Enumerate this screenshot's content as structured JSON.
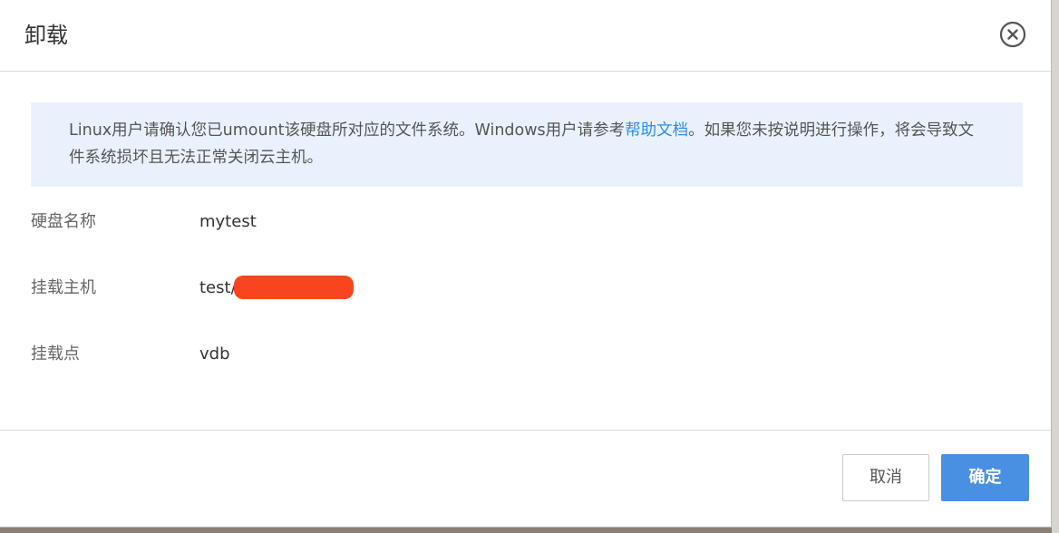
{
  "dialog": {
    "title": "卸载",
    "close_icon": "close-circle-icon"
  },
  "notice": {
    "text_before_link": "Linux用户请确认您已umount该硬盘所对应的文件系统。Windows用户请参考",
    "link_text": "帮助文档",
    "text_after_link": "。如果您未按说明进行操作，将会导致文件系统损坏且无法正常关闭云主机。",
    "link_color": "#2d8cf0",
    "background_color": "#e9f2fc"
  },
  "fields": {
    "disk_name_label": "硬盘名称",
    "disk_name_value": "mytest",
    "host_label": "挂载主机",
    "host_value": "test/",
    "mount_point_label": "挂载点",
    "mount_point_value": "vdb"
  },
  "buttons": {
    "cancel_label": "取消",
    "ok_label": "确定",
    "ok_color": "#4a90e2"
  }
}
